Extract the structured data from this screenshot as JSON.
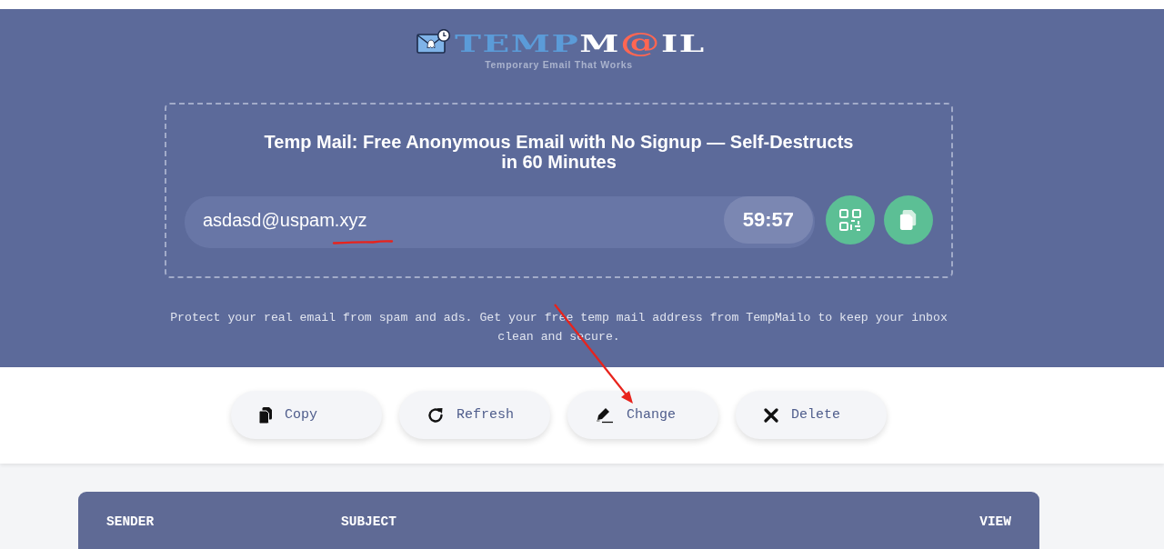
{
  "logo": {
    "segments": [
      {
        "text": "TEMP",
        "color": "#5b9bd8",
        "kind": "letters"
      },
      {
        "text": "M",
        "color": "#ffffff",
        "kind": "letters"
      },
      {
        "text": "@",
        "color": "#ff6652",
        "kind": "symbol"
      },
      {
        "text": "IL",
        "color": "#ffffff",
        "kind": "letters"
      }
    ],
    "tagline": "Temporary Email That Works"
  },
  "hero": {
    "title": "Temp Mail: Free Anonymous Email with No Signup — Self-Destructs in 60 Minutes",
    "email": "asdasd@uspam.xyz",
    "timer": "59:57",
    "icon_buttons": [
      {
        "kind": "qr"
      },
      {
        "kind": "copy"
      }
    ],
    "description": "Protect your real email from spam and ads. Get your free temp mail address from TempMailo to keep your inbox clean and secure."
  },
  "actions": [
    {
      "label": "Copy",
      "kind": "copy"
    },
    {
      "label": "Refresh",
      "kind": "refresh"
    },
    {
      "label": "Change",
      "kind": "change"
    },
    {
      "label": "Delete",
      "kind": "delete"
    }
  ],
  "inbox": {
    "columns": [
      "SENDER",
      "SUBJECT",
      "VIEW"
    ]
  }
}
